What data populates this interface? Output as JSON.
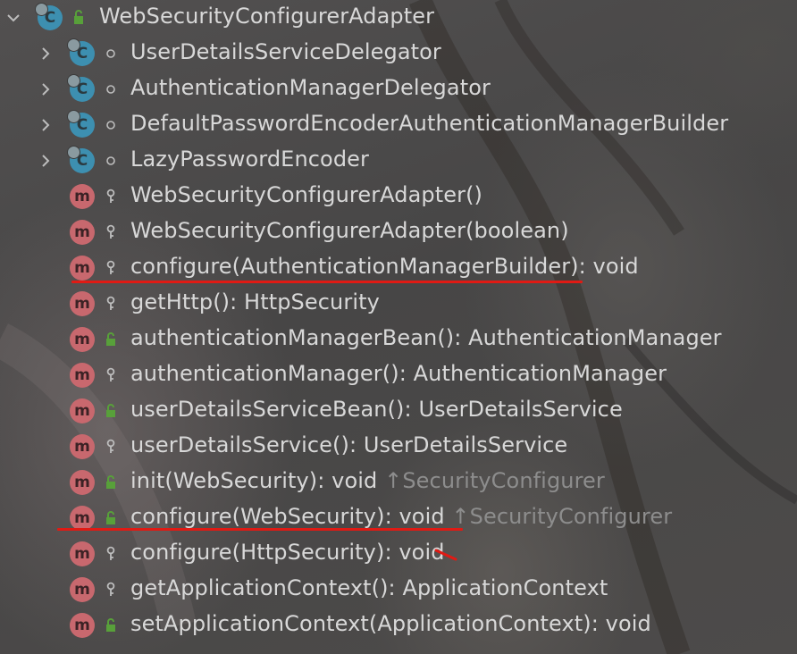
{
  "root": {
    "name": "WebSecurityConfigurerAdapter",
    "icon": "class-icon"
  },
  "nested_classes": [
    {
      "name": "UserDetailsServiceDelegator"
    },
    {
      "name": "AuthenticationManagerDelegator"
    },
    {
      "name": "DefaultPasswordEncoderAuthenticationManagerBuilder"
    },
    {
      "name": "LazyPasswordEncoder"
    }
  ],
  "methods": [
    {
      "signature": "WebSecurityConfigurerAdapter()",
      "suffix": "",
      "visibility": "protected"
    },
    {
      "signature": "WebSecurityConfigurerAdapter(boolean)",
      "suffix": "",
      "visibility": "protected"
    },
    {
      "signature": "configure(AuthenticationManagerBuilder): void",
      "suffix": "",
      "visibility": "protected"
    },
    {
      "signature": "getHttp(): HttpSecurity",
      "suffix": "",
      "visibility": "protected"
    },
    {
      "signature": "authenticationManagerBean(): AuthenticationManager",
      "suffix": "",
      "visibility": "public"
    },
    {
      "signature": "authenticationManager(): AuthenticationManager",
      "suffix": "",
      "visibility": "protected"
    },
    {
      "signature": "userDetailsServiceBean(): UserDetailsService",
      "suffix": "",
      "visibility": "public"
    },
    {
      "signature": "userDetailsService(): UserDetailsService",
      "suffix": "",
      "visibility": "protected"
    },
    {
      "signature": "init(WebSecurity): void",
      "suffix": "↑SecurityConfigurer",
      "visibility": "public"
    },
    {
      "signature": "configure(WebSecurity): void",
      "suffix": "↑SecurityConfigurer",
      "visibility": "public"
    },
    {
      "signature": "configure(HttpSecurity): void",
      "suffix": "",
      "visibility": "protected"
    },
    {
      "signature": "getApplicationContext(): ApplicationContext",
      "suffix": "",
      "visibility": "protected"
    },
    {
      "signature": "setApplicationContext(ApplicationContext): void",
      "suffix": "",
      "visibility": "public"
    }
  ],
  "colors": {
    "text": "#d8d8d8",
    "suffix": "#8d8d8d",
    "class_icon": "#3d8fb0",
    "method_icon": "#c8686e",
    "public_lock": "#58a03a",
    "annotation_red": "#e01a14"
  }
}
